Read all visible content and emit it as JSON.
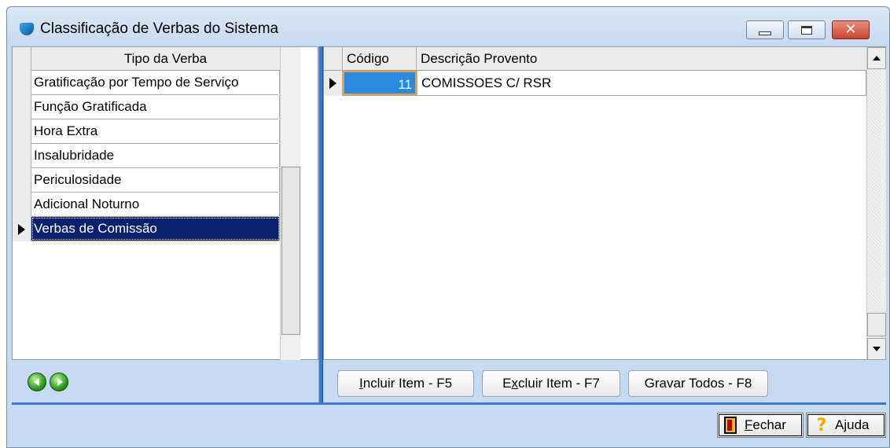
{
  "window": {
    "title": "Classificação de Verbas do Sistema"
  },
  "left_grid": {
    "header": "Tipo da Verba",
    "rows": [
      "Gratificação por Tempo de Serviço",
      "Função Gratificada",
      "Hora Extra",
      "Insalubridade",
      "Periculosidade",
      "Adicional Noturno",
      "Verbas de Comissão"
    ],
    "selected_index": 6
  },
  "right_grid": {
    "headers": {
      "code": "Código",
      "description": "Descrição Provento"
    },
    "rows": [
      {
        "code": "11",
        "description": "COMISSOES C/ RSR"
      }
    ]
  },
  "actions": {
    "incluir": {
      "first": "I",
      "rest": "ncluir Item - F5"
    },
    "excluir": {
      "pre": "E",
      "acc": "x",
      "rest": "cluir Item - F7"
    },
    "gravar": "Gravar Todos - F8"
  },
  "footer": {
    "fechar": {
      "first": "F",
      "rest": "echar"
    },
    "ajuda": "Ajuda"
  },
  "icons": {
    "app": "app-icon",
    "prev": "nav-prev-icon",
    "next": "nav-next-icon",
    "fechar": "door-exit-icon",
    "ajuda": "help-question-icon"
  },
  "colors": {
    "window_bg": "#c6dbf1",
    "selection": "#0a1f6e",
    "accent": "#3e76c9"
  }
}
